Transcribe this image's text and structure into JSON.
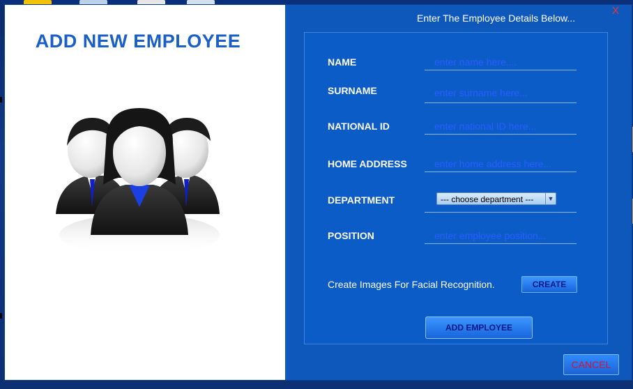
{
  "left_panel": {
    "title": "ADD NEW EMPLOYEE",
    "image": "employees-group-icon"
  },
  "header": {
    "text": "Enter The Employee Details Below...",
    "close_label": "X"
  },
  "form": {
    "fields": [
      {
        "label": "NAME",
        "placeholder": "enter name here...."
      },
      {
        "label": "SURNAME",
        "placeholder": "enter surname here..."
      },
      {
        "label": "NATIONAL ID",
        "placeholder": "enter national ID here..."
      },
      {
        "label": "HOME ADDRESS",
        "placeholder": "enter home address here..."
      },
      {
        "label": "DEPARTMENT",
        "selected": "--- choose department ---"
      },
      {
        "label": "POSITION",
        "placeholder": "enter employee position..."
      }
    ],
    "facial_text": "Create Images For Facial Recognition.",
    "create_label": "CREATE",
    "add_label": "ADD EMPLOYEE"
  },
  "footer": {
    "cancel_label": "CANCEL"
  },
  "colors": {
    "window_bg": "#0f58bb",
    "title_blue": "#1a5fc7",
    "placeholder": "#2a5cff",
    "cancel_text": "#d4143a"
  }
}
